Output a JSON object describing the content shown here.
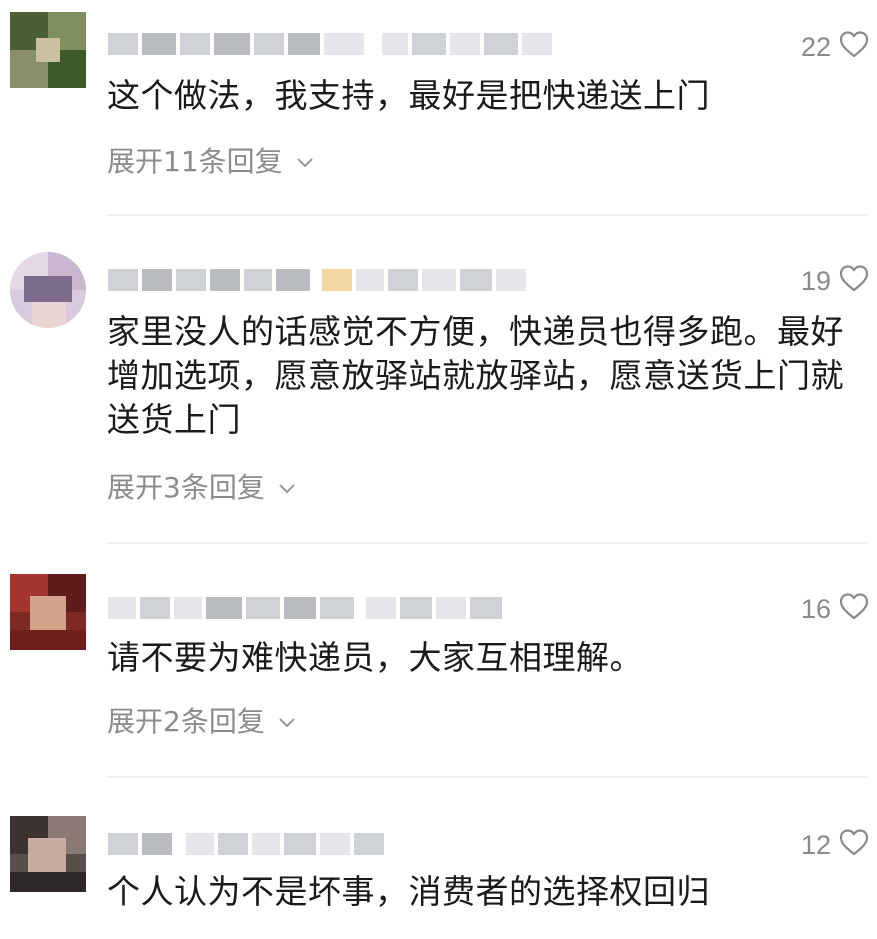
{
  "comments": [
    {
      "likes": "22",
      "text": "这个做法，我支持，最好是把快递送上门",
      "replies": "展开11条回复"
    },
    {
      "likes": "19",
      "text": "家里没人的话感觉不方便，快递员也得多跑。最好增加选项，愿意放驿站就放驿站，愿意送货上门就送货上门",
      "replies": "展开3条回复"
    },
    {
      "likes": "16",
      "text": "请不要为难快递员，大家互相理解。",
      "replies": "展开2条回复"
    },
    {
      "likes": "12",
      "text": "个人认为不是坏事，消费者的选择权回归"
    }
  ],
  "icons": {
    "like": "heart-outline-icon",
    "expand": "chevron-down-icon"
  },
  "colors": {
    "meta_text": "#8c8c8c",
    "body_text": "#1a1a1a",
    "divider": "#eeeeee",
    "blur_placeholder": "#cfd2d6"
  }
}
